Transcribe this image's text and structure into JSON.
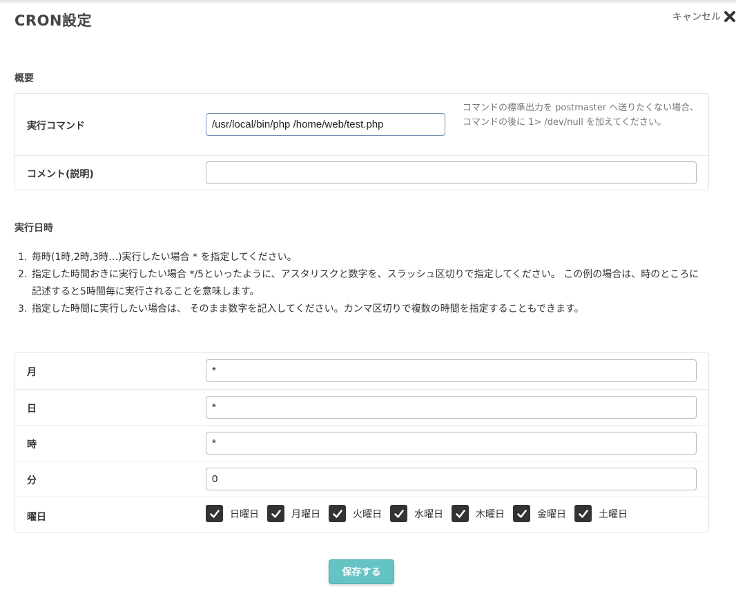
{
  "header": {
    "title": "CRON設定",
    "cancel_label": "キャンセル"
  },
  "overview": {
    "section_title": "概要",
    "command": {
      "label": "実行コマンド",
      "value": "/usr/local/bin/php /home/web/test.php",
      "help": "コマンドの標準出力を postmaster へ送りたくない場合、コマンドの後に 1> /dev/null を加えてください。"
    },
    "comment": {
      "label": "コメント(説明)",
      "value": ""
    }
  },
  "schedule": {
    "section_title": "実行日時",
    "notes": [
      {
        "num": "1.",
        "text": "毎時(1時,2時,3時…)実行したい場合 * を指定してください。"
      },
      {
        "num": "2.",
        "text": "指定した時間おきに実行したい場合 */5といったように、アスタリスクと数字を、スラッシュ区切りで指定してください。 この例の場合は、時のところに記述すると5時間毎に実行されることを意味します。"
      },
      {
        "num": "3.",
        "text": "指定した時間に実行したい場合は、 そのまま数字を記入してください。カンマ区切りで複数の時間を指定することもできます。"
      }
    ],
    "month": {
      "label": "月",
      "value": "*"
    },
    "day": {
      "label": "日",
      "value": "*"
    },
    "hour": {
      "label": "時",
      "value": "*"
    },
    "minute": {
      "label": "分",
      "value": "0"
    },
    "weekday": {
      "label": "曜日",
      "days": [
        {
          "label": "日曜日",
          "checked": true
        },
        {
          "label": "月曜日",
          "checked": true
        },
        {
          "label": "火曜日",
          "checked": true
        },
        {
          "label": "水曜日",
          "checked": true
        },
        {
          "label": "木曜日",
          "checked": true
        },
        {
          "label": "金曜日",
          "checked": true
        },
        {
          "label": "土曜日",
          "checked": true
        }
      ]
    }
  },
  "footer": {
    "save_label": "保存する"
  },
  "colors": {
    "save_button": "#66c3c4",
    "checkbox": "#333333"
  },
  "icons": {
    "cancel": "close-icon",
    "checkbox": "check-icon"
  }
}
